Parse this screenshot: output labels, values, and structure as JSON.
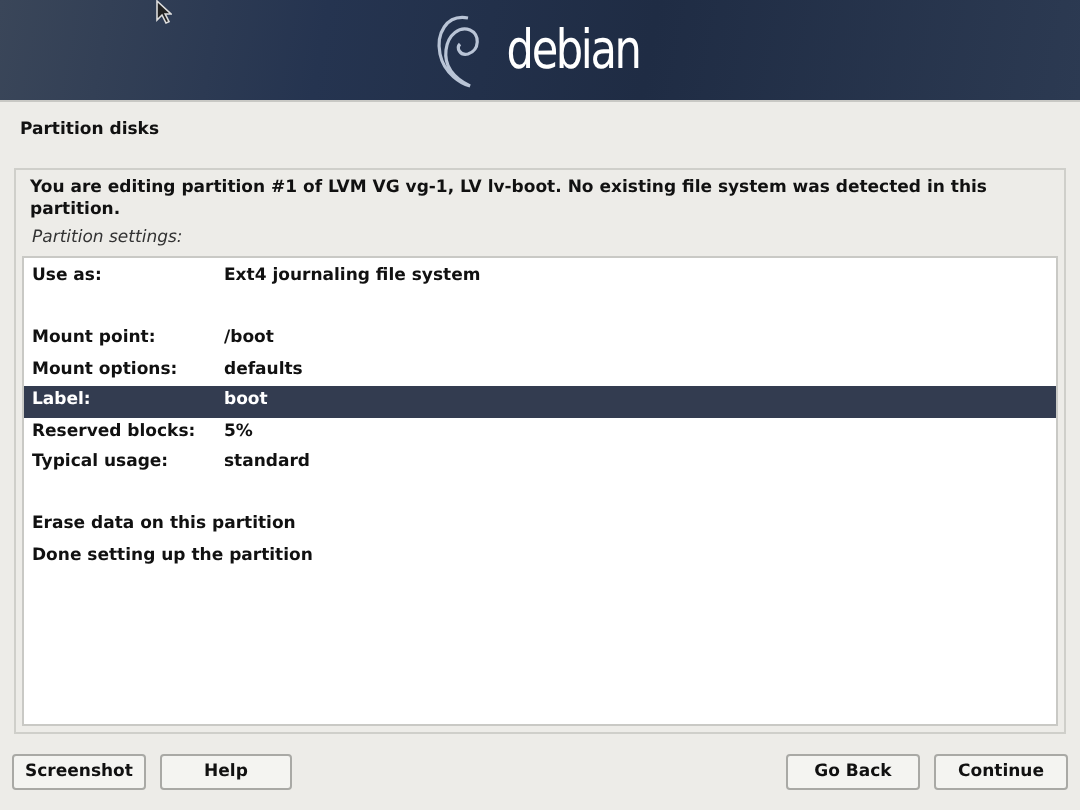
{
  "header": {
    "logo_text": "debian"
  },
  "title": "Partition disks",
  "message": "You are editing partition #1 of LVM VG vg-1, LV lv-boot. No existing file system was detected in this partition.",
  "list_label": "Partition settings:",
  "rows": [
    {
      "kind": "setting",
      "label": "Use as:",
      "value": "Ext4 journaling file system",
      "selected": false
    },
    {
      "kind": "blank"
    },
    {
      "kind": "setting",
      "label": "Mount point:",
      "value": "/boot",
      "selected": false
    },
    {
      "kind": "setting",
      "label": "Mount options:",
      "value": "defaults",
      "selected": false
    },
    {
      "kind": "setting",
      "label": "Label:",
      "value": "boot",
      "selected": true
    },
    {
      "kind": "setting",
      "label": "Reserved blocks:",
      "value": "5%",
      "selected": false
    },
    {
      "kind": "setting",
      "label": "Typical usage:",
      "value": "standard",
      "selected": false
    },
    {
      "kind": "blank"
    },
    {
      "kind": "action",
      "label": "Erase data on this partition",
      "selected": false
    },
    {
      "kind": "action",
      "label": "Done setting up the partition",
      "selected": false
    }
  ],
  "buttons_left": [
    "Screenshot",
    "Help"
  ],
  "buttons_right": [
    "Go Back",
    "Continue"
  ]
}
